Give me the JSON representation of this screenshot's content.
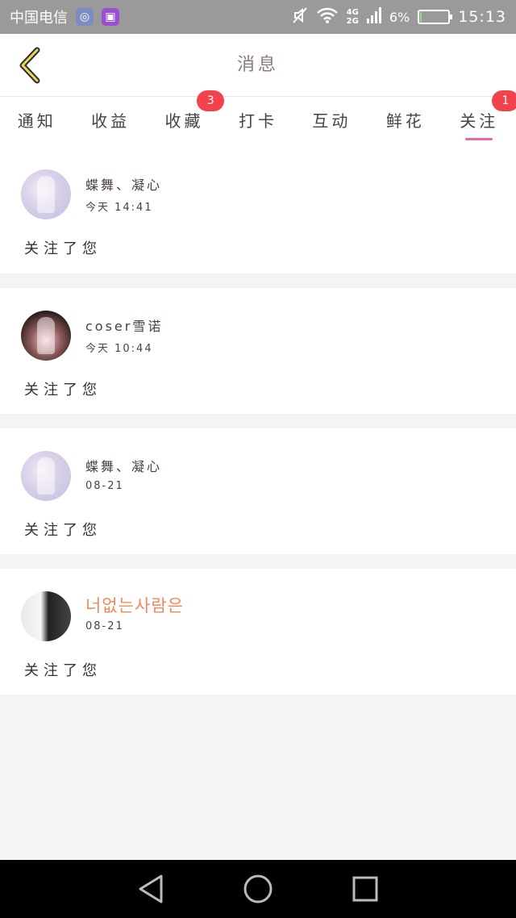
{
  "status_bar": {
    "carrier": "中国电信",
    "net_top": "4G",
    "net_bottom": "2G",
    "battery": "6%",
    "battery_level": 0.06,
    "time": "15:13"
  },
  "header": {
    "title": "消息",
    "back_icon": "chevron-left-icon"
  },
  "tabs": [
    {
      "label": "通知",
      "badge": null
    },
    {
      "label": "收益",
      "badge": null
    },
    {
      "label": "收藏",
      "badge": "3"
    },
    {
      "label": "打卡",
      "badge": null
    },
    {
      "label": "互动",
      "badge": null
    },
    {
      "label": "鲜花",
      "badge": null
    },
    {
      "label": "关注",
      "badge": "1",
      "active": true
    }
  ],
  "messages": [
    {
      "username": "蝶舞、凝心",
      "time": "今天 14:41",
      "text": "关注了您"
    },
    {
      "username": "coser雪诺",
      "time": "今天 10:44",
      "text": "关注了您"
    },
    {
      "username": "蝶舞、凝心",
      "time": "08-21",
      "text": "关注了您"
    },
    {
      "username": "너없는사람은",
      "time": "08-21",
      "text": "关注了您"
    }
  ],
  "colors": {
    "accent": "#e66aa0",
    "badge": "#f2424b",
    "highlight_name": "#f08a5d"
  },
  "nav": {
    "back": "triangle-back-icon",
    "home": "circle-home-icon",
    "recent": "square-recent-icon"
  }
}
